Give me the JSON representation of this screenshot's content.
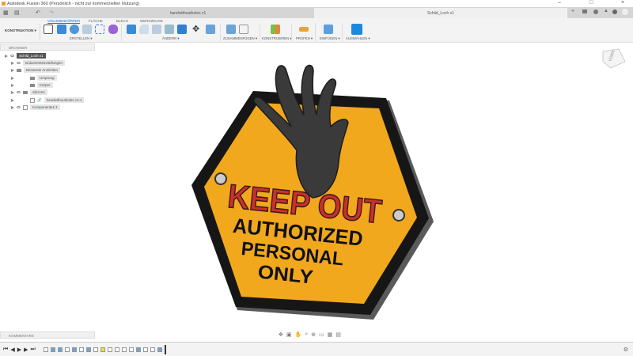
{
  "window": {
    "title": "Autodesk Fusion 360 (Persönlich - nicht zur kommerziellen Nutzung)",
    "min": "–",
    "max": "□",
    "close": "×"
  },
  "doc_tabs": [
    {
      "label": "handwithoutholes v1"
    },
    {
      "label": "Schild_Loch v1",
      "active": true
    }
  ],
  "ribbon": {
    "workspace": "KONSTRUKTION ▾",
    "tabs": [
      "VOLUMENKÖRPER",
      "FLÄCHE",
      "BLECH",
      "WERKZEUGE"
    ],
    "groups": [
      "ERSTELLEN ▾",
      "ÄNDERN ▾",
      "ZUSAMMENFÜGEN ▾",
      "KONSTRUIEREN ▾",
      "PRÜFEN ▾",
      "EINFÜGEN ▾",
      "AUSWÄHLEN ▾"
    ]
  },
  "browser": {
    "title": "BROWSER",
    "root": "Schild_Loch v1",
    "items": [
      "Dokumenteinstellungen",
      "Benannte Ansichten",
      "Ursprung",
      "Körper",
      "Skizzen",
      "handwithoutholes v1:1",
      "Komponente1:1"
    ]
  },
  "comments": {
    "title": "KOMMENTARE"
  },
  "sign": {
    "line1": "KEEP OUT",
    "line2": "AUTHORIZED",
    "line3": "PERSONAL",
    "line4": "ONLY"
  },
  "viewcube": {
    "label": "VORN"
  },
  "colors": {
    "accent": "#1a73c8",
    "sign_yellow": "#f2a81d",
    "sign_red": "#c9302c"
  }
}
